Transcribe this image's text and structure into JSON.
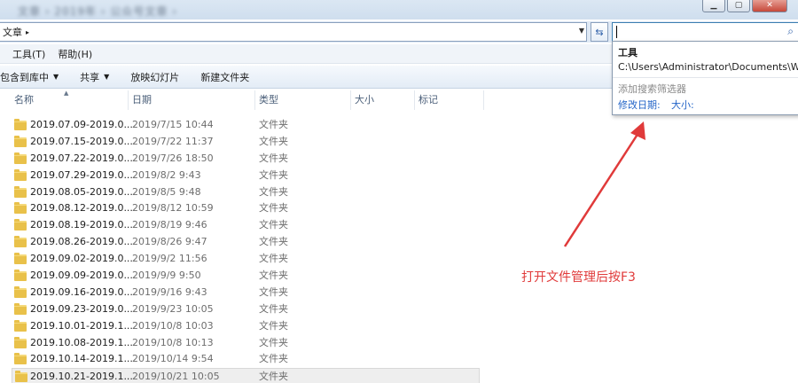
{
  "window": {
    "blurred_title": "文章 › 2019年 › 公众号文章 ›"
  },
  "address": {
    "crumb": "文章",
    "crumb_arrow": "▸"
  },
  "search": {
    "value": "",
    "icon": "search-icon"
  },
  "menu": {
    "items": [
      "工具(T)",
      "帮助(H)"
    ]
  },
  "toolbar": {
    "items": [
      {
        "label": "包含到库中",
        "has_dropdown": true
      },
      {
        "label": "共享",
        "has_dropdown": true
      },
      {
        "label": "放映幻灯片",
        "has_dropdown": false
      },
      {
        "label": "新建文件夹",
        "has_dropdown": false
      }
    ]
  },
  "columns": {
    "name": "名称",
    "date": "日期",
    "type": "类型",
    "size": "大小",
    "tags": "标记"
  },
  "files": [
    {
      "name": "2019.07.09-2019.0...",
      "date": "2019/7/15 10:44",
      "type": "文件夹"
    },
    {
      "name": "2019.07.15-2019.0...",
      "date": "2019/7/22 11:37",
      "type": "文件夹"
    },
    {
      "name": "2019.07.22-2019.0...",
      "date": "2019/7/26 18:50",
      "type": "文件夹"
    },
    {
      "name": "2019.07.29-2019.0...",
      "date": "2019/8/2 9:43",
      "type": "文件夹"
    },
    {
      "name": "2019.08.05-2019.0...",
      "date": "2019/8/5 9:48",
      "type": "文件夹"
    },
    {
      "name": "2019.08.12-2019.0...",
      "date": "2019/8/12 10:59",
      "type": "文件夹"
    },
    {
      "name": "2019.08.19-2019.0...",
      "date": "2019/8/19 9:46",
      "type": "文件夹"
    },
    {
      "name": "2019.08.26-2019.0...",
      "date": "2019/8/26 9:47",
      "type": "文件夹"
    },
    {
      "name": "2019.09.02-2019.0...",
      "date": "2019/9/2 11:56",
      "type": "文件夹"
    },
    {
      "name": "2019.09.09-2019.0...",
      "date": "2019/9/9 9:50",
      "type": "文件夹"
    },
    {
      "name": "2019.09.16-2019.0...",
      "date": "2019/9/16 9:43",
      "type": "文件夹"
    },
    {
      "name": "2019.09.23-2019.0...",
      "date": "2019/9/23 10:05",
      "type": "文件夹"
    },
    {
      "name": "2019.10.01-2019.1...",
      "date": "2019/10/8 10:03",
      "type": "文件夹"
    },
    {
      "name": "2019.10.08-2019.1...",
      "date": "2019/10/8 10:13",
      "type": "文件夹"
    },
    {
      "name": "2019.10.14-2019.1...",
      "date": "2019/10/14 9:54",
      "type": "文件夹"
    },
    {
      "name": "2019.10.21-2019.1...",
      "date": "2019/10/21 10:05",
      "type": "文件夹",
      "selected": true
    }
  ],
  "search_popup": {
    "heading": "工具",
    "path": "C:\\Users\\Administrator\\Documents\\W...",
    "filters_label": "添加搜索筛选器",
    "filter_date": "修改日期:",
    "filter_size": "大小:"
  },
  "annotation": {
    "text": "打开文件管理后按F3",
    "color": "#e03a3a"
  }
}
